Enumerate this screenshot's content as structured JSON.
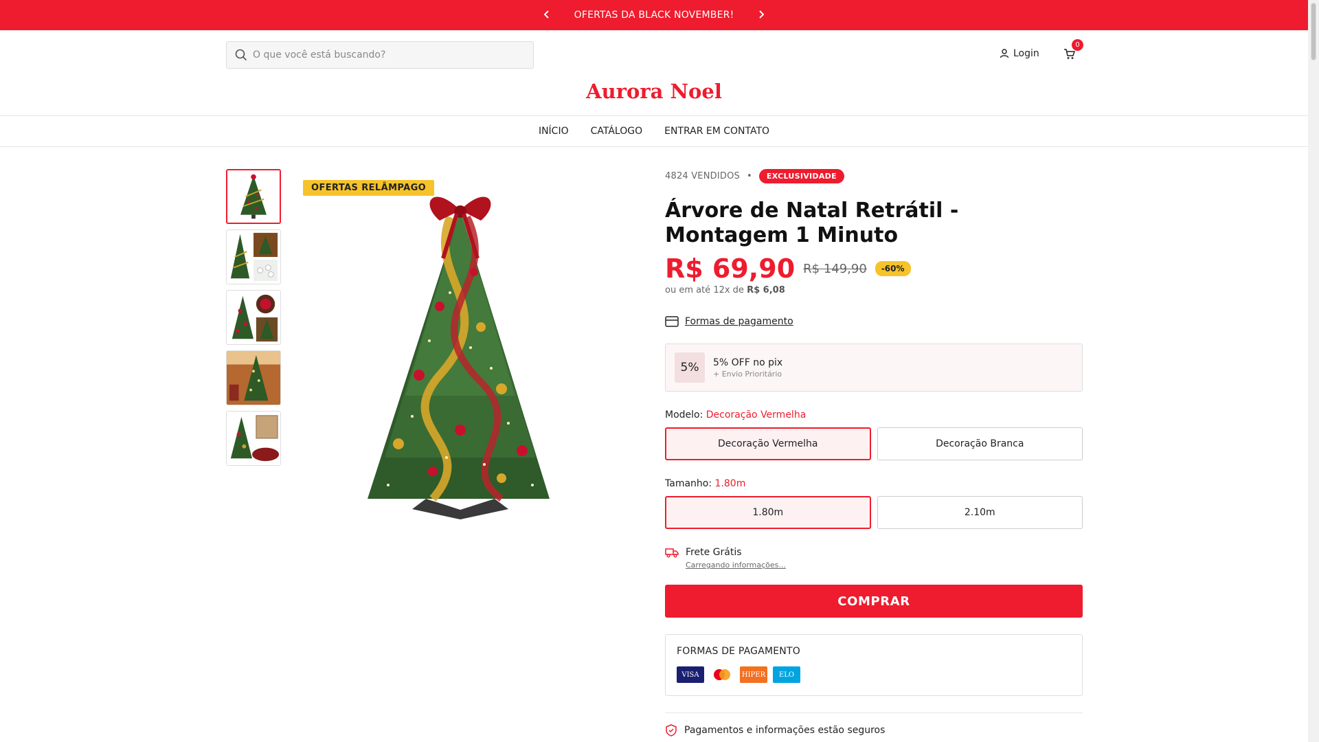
{
  "announcement": {
    "text": "OFERTAS DA BLACK NOVEMBER!",
    "prev_icon": "chevron-left-icon",
    "next_icon": "chevron-right-icon"
  },
  "header": {
    "search_placeholder": "O que você está buscando?",
    "login_label": "Login",
    "cart_count": "0",
    "logo": "Aurora Noel"
  },
  "nav": {
    "items": [
      "INÍCIO",
      "CATÁLOGO",
      "ENTRAR EM CONTATO"
    ]
  },
  "gallery": {
    "badge": "OFERTAS RELÂMPAGO",
    "thumb_count": 5
  },
  "product": {
    "sold": "4824 VENDIDOS",
    "separator": "•",
    "exclusive_badge": "EXCLUSIVIDADE",
    "title": "Árvore de Natal Retrátil - Montagem 1 Minuto",
    "price": "R$ 69,90",
    "old_price": "R$ 149,90",
    "discount": "-60%",
    "installments_prefix": "ou em até 12x de",
    "installments_value": "R$ 6,08",
    "payment_link": "Formas de pagamento"
  },
  "pix": {
    "percent": "5%",
    "title": "5% OFF no pix",
    "subtitle": "+ Envio Prioritário"
  },
  "model": {
    "label": "Modelo:",
    "selected": "Decoração Vermelha",
    "options": [
      "Decoração Vermelha",
      "Decoração Branca"
    ]
  },
  "size": {
    "label": "Tamanho:",
    "selected": "1.80m",
    "options": [
      "1.80m",
      "2.10m"
    ]
  },
  "shipping": {
    "title": "Frete Grátis",
    "subtitle": "Carregando informações..."
  },
  "buy_label": "COMPRAR",
  "payment_box": {
    "title": "FORMAS DE PAGAMENTO",
    "cards": [
      {
        "name": "VISA",
        "color": "#1a1f71"
      },
      {
        "name": "mastercard",
        "color": "#eb001b"
      },
      {
        "name": "HIPER",
        "color": "#f37021"
      },
      {
        "name": "ELO",
        "color": "#00a4e0"
      }
    ]
  },
  "secure_text": "Pagamentos e informações estão seguros",
  "colors": {
    "brand": "#ee1c2e",
    "accent": "#f6c32b"
  }
}
